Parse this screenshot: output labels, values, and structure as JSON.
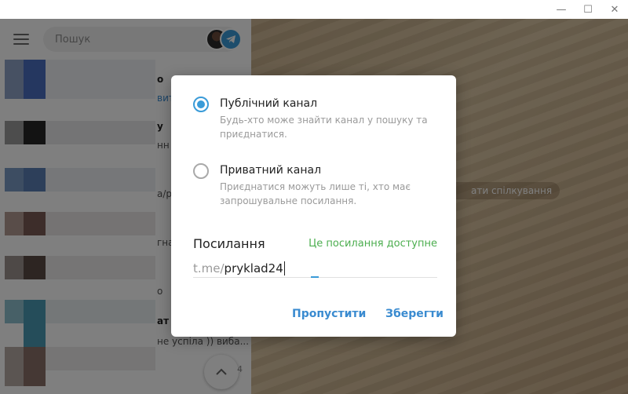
{
  "titlebar": {
    "minimize_glyph": "—",
    "maximize_glyph": "☐",
    "close_glyph": "✕"
  },
  "left_panel": {
    "search": {
      "placeholder": "Пошук"
    },
    "visible_snippets": [
      {
        "text": "о",
        "style": "bold"
      },
      {
        "text": "вит",
        "style": "blue"
      },
      {
        "text": "у",
        "style": "bold"
      },
      {
        "text": "нн",
        "style": "normal"
      },
      {
        "text": "а/р",
        "style": "normal"
      },
      {
        "text": "гна",
        "style": "normal"
      },
      {
        "text": "о",
        "style": "normal"
      },
      {
        "text": "ат",
        "style": "bold"
      },
      {
        "text": "не успіла )) виба...",
        "style": "normal"
      }
    ],
    "fab_count": "4"
  },
  "right_panel": {
    "hint": "ати спілкування"
  },
  "dialog": {
    "options": [
      {
        "title": "Публічний канал",
        "description": "Будь-хто може знайти канал у пошуку та приєднатися.",
        "checked": true
      },
      {
        "title": "Приватний канал",
        "description": "Приєднатися можуть лише ті, хто має запрошувальне посилання.",
        "checked": false
      }
    ],
    "link": {
      "label": "Посилання",
      "status": "Це посилання доступне",
      "prefix": "t.me/",
      "value": "pryklad24"
    },
    "buttons": {
      "skip": "Пропустити",
      "save": "Зберегти"
    }
  },
  "colors": {
    "accent": "#3a9bd8",
    "success": "#4cae4f",
    "link_button": "#3a8bd0"
  }
}
